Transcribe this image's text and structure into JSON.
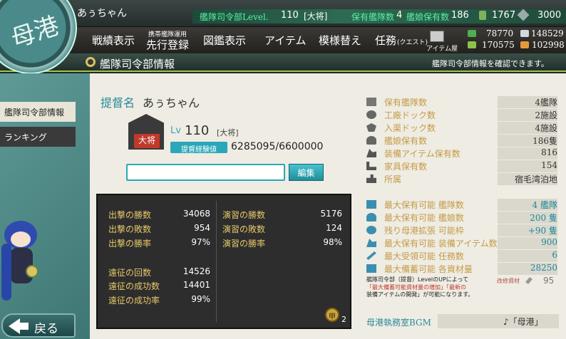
{
  "top": {
    "admiral_name": "あぅちゃん",
    "hq_level_label": "艦隊司令部Level.",
    "hq_level": "110",
    "rank": "[大将]",
    "fleets_label": "保有艦隊数",
    "fleets": "4",
    "ships_label": "艦娘保有数",
    "ships": "186",
    "buckets": "1767",
    "dev_materials": "3000"
  },
  "menu": {
    "record": "戦績表示",
    "preorder_small": "携帯艦隊運用",
    "preorder": "先行登録",
    "encyclopedia": "図鑑表示",
    "items": "アイテム",
    "furniture": "模様替え",
    "quest": "任務",
    "quest_small": "(クエスト)",
    "shop_small": "アイテム屋"
  },
  "resources": {
    "fuel": "78770",
    "ammo": "170575",
    "steel": "148529",
    "bauxite": "102998"
  },
  "section": {
    "title": "艦隊司令部情報",
    "hint": "艦隊司令部情報を確認できます。"
  },
  "nav": {
    "hq_info": "艦隊司令部情報",
    "ranking": "ランキング"
  },
  "profile": {
    "admiral_label": "提督名",
    "admiral_name": "あぅちゃん",
    "lv_label": "Lv",
    "lv": "110",
    "rank": "[大将]",
    "rank_emblem": "大将",
    "exp_label": "提督経験値",
    "exp": "6285095/6600000",
    "comment": "",
    "edit_label": "編集"
  },
  "record": {
    "sortie": [
      {
        "label": "出撃の勝数",
        "value": "34068"
      },
      {
        "label": "出撃の敗数",
        "value": "954"
      },
      {
        "label": "出撃の勝率",
        "value": "97%"
      }
    ],
    "exercise": [
      {
        "label": "演習の勝数",
        "value": "5176"
      },
      {
        "label": "演習の敗数",
        "value": "124"
      },
      {
        "label": "演習の勝率",
        "value": "98%"
      }
    ],
    "expedition": [
      {
        "label": "遠征の回数",
        "value": "14526"
      },
      {
        "label": "遠征の成功数",
        "value": "14401"
      },
      {
        "label": "遠征の成功率",
        "value": "99%"
      }
    ],
    "medal_count": "2",
    "medal_label": "甲"
  },
  "stats": [
    {
      "label": "保有艦隊数",
      "value": "4艦隊"
    },
    {
      "label": "工廠ドック数",
      "value": "2施設"
    },
    {
      "label": "入渠ドック数",
      "value": "4施設"
    },
    {
      "label": "艦娘保有数",
      "value": "186隻"
    },
    {
      "label": "装備アイテム保有数",
      "value": "816"
    },
    {
      "label": "家具保有数",
      "value": "154"
    },
    {
      "label": "所属",
      "value": "宿毛湾泊地"
    }
  ],
  "limits": [
    {
      "label": "最大保有可能 艦隊数",
      "value": "4 艦隊"
    },
    {
      "label": "最大保有可能 艦娘数",
      "value": "200 隻"
    },
    {
      "label": "残り母港拡張 可能枠",
      "value": "+90 隻"
    },
    {
      "label": "最大保有可能 装備アイテム数",
      "value": "900"
    },
    {
      "label": "最大受領可能 任務数",
      "value": "6"
    },
    {
      "label": "最大備蓄可能 各資材量",
      "value": "28250"
    }
  ],
  "note": {
    "line1": "艦隊司令部（提督）LevelのUPによって",
    "line2": "「最大備蓄可能資材量の増加」「最新の",
    "line3": "装備アイテムの開発」が可能になります。"
  },
  "kaishu": {
    "label": "改修資材",
    "value": "95"
  },
  "bgm": {
    "label": "母港執務室BGM",
    "value": "♪「母港」"
  },
  "back_label": "戻る",
  "colors": {
    "accent_teal": "#2aa7b8",
    "gold_label": "#c59a46",
    "record_label": "#e7c86a"
  }
}
